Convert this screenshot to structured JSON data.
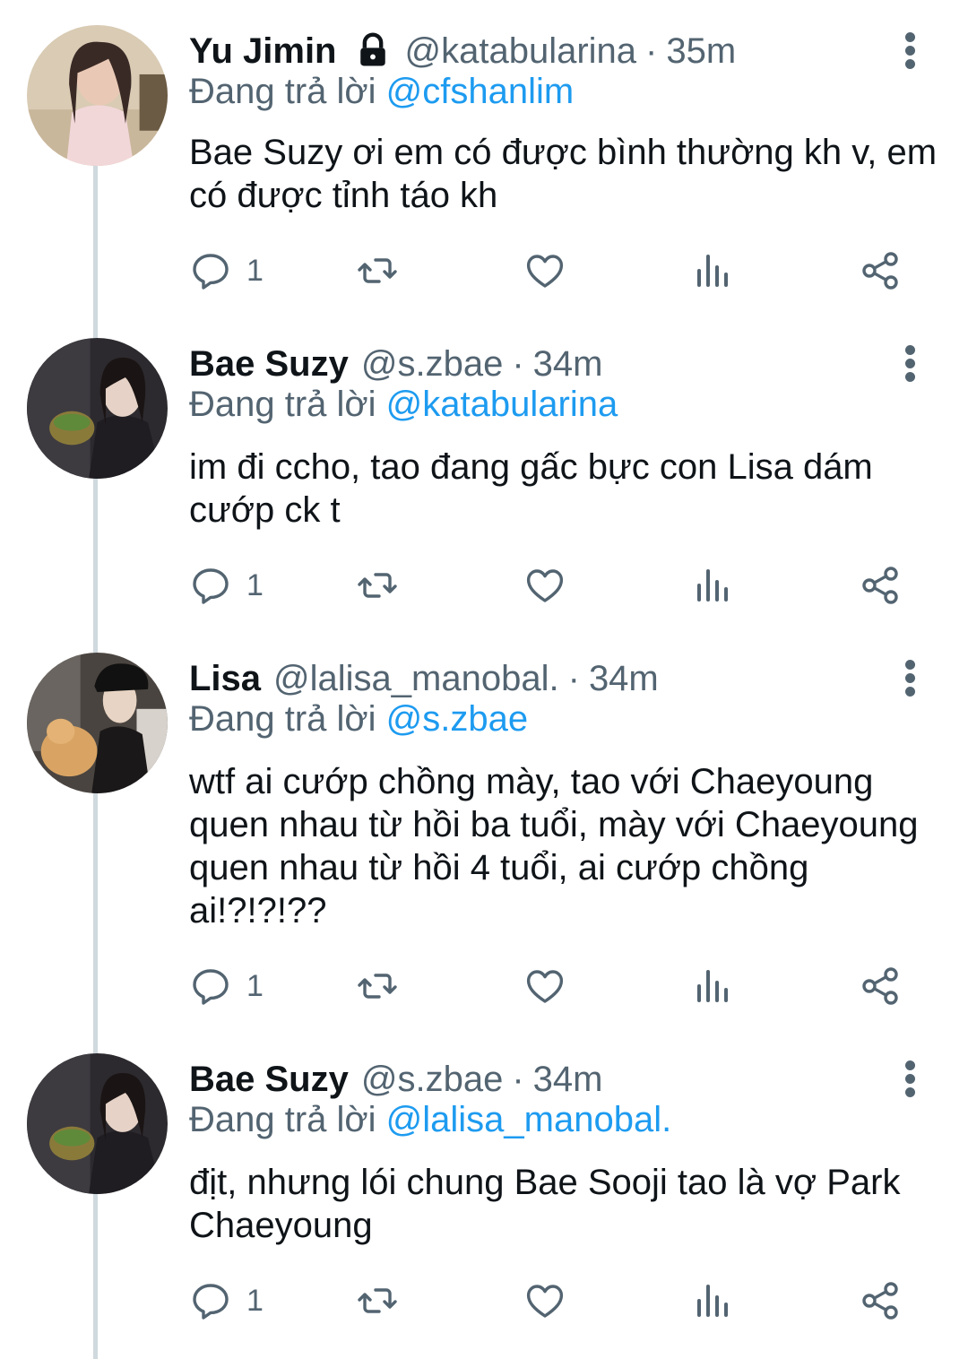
{
  "reply_prefix": "Đang trả lời",
  "tweets": [
    {
      "name": "Yu Jimin",
      "handle": "@katabularina",
      "time": "35m",
      "reply_to": "@cfshanlim",
      "text": "Bae Suzy ơi em có được bình thường kh v, em có được tỉnh táo kh",
      "reply_count": "1",
      "locked": true,
      "avatar": "avatar-photo"
    },
    {
      "name": "Bae Suzy",
      "handle": "@s.zbae",
      "time": "34m",
      "reply_to": "@katabularina",
      "text": "im đi ccho, tao đang gấc bực con Lisa dám cướp ck t",
      "reply_count": "1",
      "locked": false,
      "avatar": "avatar-photo"
    },
    {
      "name": "Lisa",
      "handle": "@lalisa_manobal.",
      "time": "34m",
      "reply_to": "@s.zbae",
      "text": "wtf ai cướp chồng mày, tao với Chaeyoung quen nhau từ hồi ba tuổi, mày với Chaeyoung quen nhau từ hồi 4 tuổi, ai cướp chồng ai!?!?!??",
      "reply_count": "1",
      "locked": false,
      "avatar": "avatar-photo"
    },
    {
      "name": "Bae Suzy",
      "handle": "@s.zbae",
      "time": "34m",
      "reply_to": "@lalisa_manobal.",
      "text": "địt, nhưng lói chung Bae Sooji tao là vợ Park Chaeyoung",
      "reply_count": "1",
      "locked": false,
      "avatar": "avatar-photo"
    }
  ],
  "icons": [
    "lock-icon",
    "more-icon",
    "reply-icon",
    "retweet-icon",
    "like-icon",
    "views-icon",
    "share-icon"
  ],
  "colors": {
    "text": "#0f1419",
    "secondary": "#536471",
    "mention": "#1d9bf0",
    "thread_line": "#cfd9de"
  }
}
